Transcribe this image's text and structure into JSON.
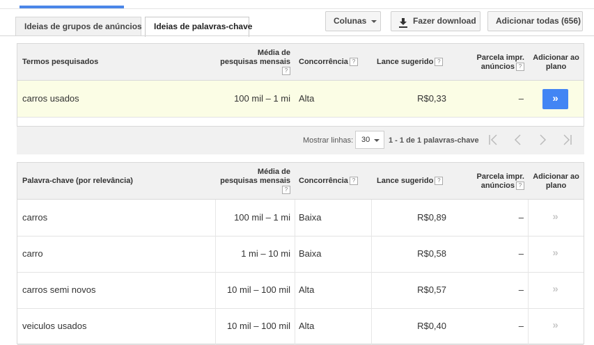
{
  "tabs": [
    {
      "label": "Ideias de grupos de anúncios",
      "active": false
    },
    {
      "label": "Ideias de palavras-chave",
      "active": true
    }
  ],
  "toolbar": {
    "columns_label": "Colunas",
    "download_label": "Fazer download",
    "add_all_label": "Adicionar todas (656)"
  },
  "columns": {
    "searched_terms": "Termos pesquisados",
    "keyword_relevance": "Palavra-chave (por relevância)",
    "avg_monthly_line1": "Média de",
    "avg_monthly_line2": "pesquisas mensais",
    "competition": "Concorrência",
    "suggested_bid": "Lance sugerido",
    "impr_share_line1": "Parcela impr.",
    "impr_share_line2": "anúncios",
    "add_to_plan_line1": "Adicionar ao",
    "add_to_plan_line2": "plano",
    "help_glyph": "?"
  },
  "searched": [
    {
      "term": "carros usados",
      "searches": "100 mil – 1 mi",
      "competition": "Alta",
      "bid": "R$0,33",
      "share": "–",
      "add": "»"
    }
  ],
  "pager": {
    "show_rows_label": "Mostrar linhas:",
    "rows_value": "30",
    "range_text": "1 - 1 de 1 palavras-chave"
  },
  "keywords": [
    {
      "term": "carros",
      "searches": "100 mil – 1 mi",
      "competition": "Baixa",
      "bid": "R$0,89",
      "share": "–",
      "add": "»"
    },
    {
      "term": "carro",
      "searches": "1 mi – 10 mi",
      "competition": "Baixa",
      "bid": "R$0,58",
      "share": "–",
      "add": "»"
    },
    {
      "term": "carros semi novos",
      "searches": "10 mil – 100 mil",
      "competition": "Alta",
      "bid": "R$0,57",
      "share": "–",
      "add": "»"
    },
    {
      "term": "veiculos usados",
      "searches": "10 mil – 100 mil",
      "competition": "Alta",
      "bid": "R$0,40",
      "share": "–",
      "add": "»"
    }
  ],
  "colors": {
    "accent": "#4285f4",
    "highlight_row": "#fbfde5",
    "header_bg": "#f1f1f1"
  }
}
